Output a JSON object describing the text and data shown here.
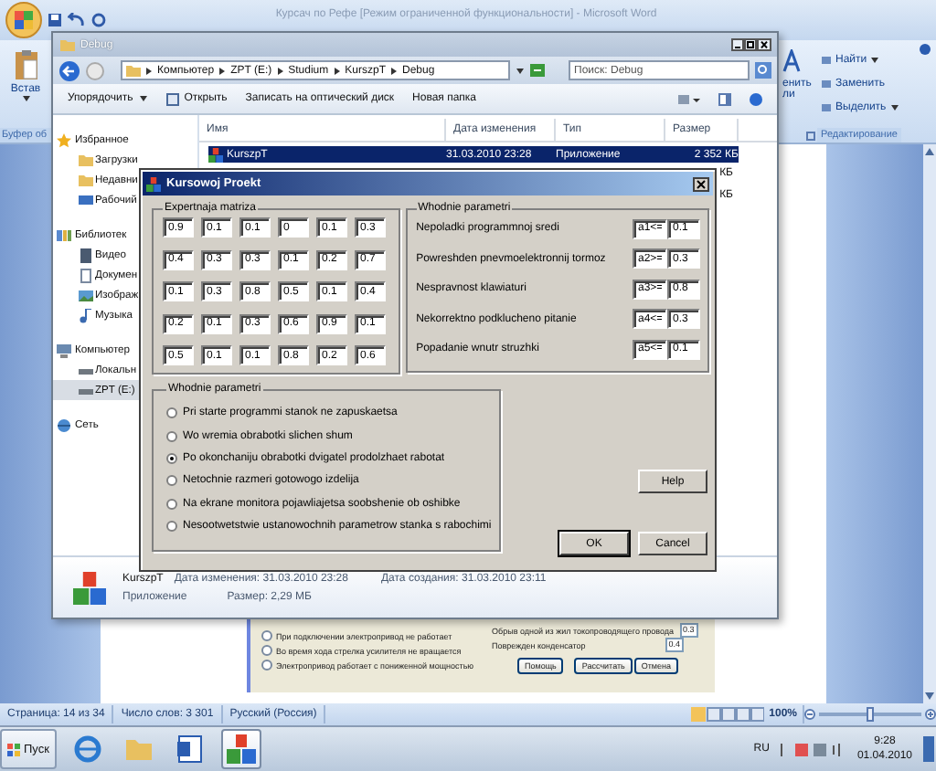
{
  "word": {
    "title": "Курсач по Рефе [Режим ограниченной функциональности] - Microsoft Word",
    "ribbon": {
      "paste_label": "Встав",
      "clipboard_group": "Буфер об",
      "styles_fragments": [
        "енить",
        "ли"
      ],
      "editing": [
        {
          "label": "Найти",
          "dropdown": true
        },
        {
          "label": "Заменить",
          "dropdown": false
        },
        {
          "label": "Выделить",
          "dropdown": true
        }
      ],
      "editing_group": "Редактирование"
    },
    "document_image": {
      "options": [
        {
          "label": "При подключении электропривод не работает",
          "selected": false
        },
        {
          "label": "Во время хода стрелка усилителя не вращается",
          "selected": false
        },
        {
          "label": "Электропривод работает с пониженной мощностью",
          "selected": false
        }
      ],
      "faults": [
        {
          "label": "Обрыв одной из жил токопроводящего провода",
          "value": "0.3"
        },
        {
          "label": "Поврежден конденсатор",
          "value": "0.4"
        }
      ],
      "buttons": [
        "Помощь",
        "Рассчитать",
        "Отмена"
      ]
    },
    "status_bar": {
      "page": "Страница: 14 из 34",
      "words": "Число слов: 3 301",
      "language": "Русский (Россия)",
      "zoom": "100%",
      "zoom_slider": {
        "level": 0.5
      }
    }
  },
  "explorer": {
    "title": "Debug",
    "breadcrumb": [
      "Компьютер",
      "ZPT (E:)",
      "Studium",
      "KurszpT",
      "Debug"
    ],
    "search": {
      "placeholder": "Поиск: Debug"
    },
    "toolbar": [
      {
        "label": "Упорядочить",
        "kind": "menu"
      },
      {
        "label": "Открыть",
        "kind": "open"
      },
      {
        "label": "Записать на оптический диск",
        "kind": "plain"
      },
      {
        "label": "Новая папка",
        "kind": "plain"
      }
    ],
    "nav": [
      {
        "label": "Избранное",
        "kind": "star",
        "selected": false,
        "children": [
          {
            "label": "Загрузки",
            "kind": "folder",
            "selected": false
          },
          {
            "label": "Недавни",
            "kind": "folder",
            "selected": false
          },
          {
            "label": "Рабочий",
            "kind": "desktop",
            "selected": false
          }
        ]
      },
      {
        "label": "Библиотек",
        "kind": "library",
        "selected": false,
        "children": [
          {
            "label": "Видео",
            "kind": "video",
            "selected": false
          },
          {
            "label": "Докумен",
            "kind": "document",
            "selected": false
          },
          {
            "label": "Изображ",
            "kind": "image",
            "selected": false
          },
          {
            "label": "Музыка",
            "kind": "music",
            "selected": false
          }
        ]
      },
      {
        "label": "Компьютер",
        "kind": "computer",
        "selected": false,
        "children": [
          {
            "label": "Локальн",
            "kind": "drive",
            "selected": false
          },
          {
            "label": "ZPT (E:)",
            "kind": "drive",
            "selected": true
          }
        ]
      },
      {
        "label": "Сеть",
        "kind": "network",
        "selected": false
      }
    ],
    "columns": [
      "Имя",
      "Дата изменения",
      "Тип",
      "Размер"
    ],
    "rows": [
      {
        "name": "KurszpT",
        "modified": "31.03.2010 23:28",
        "type": "Приложение",
        "size": "2 352 КБ",
        "selected": true
      }
    ],
    "partial_rows": [
      {
        "size": "КБ"
      },
      {
        "size": "КБ"
      }
    ],
    "details": {
      "name": "KurszpT",
      "modified": "Дата изменения: 31.03.2010 23:28",
      "created": "Дата создания: 31.03.2010 23:11",
      "type": "Приложение",
      "size": "Размер: 2,29 МБ"
    }
  },
  "dialog": {
    "title": "Kursowoj Proekt",
    "matrix": {
      "title": "Expertnaja matriza",
      "rows": [
        [
          "0.9",
          "0.1",
          "0.1",
          "0",
          "0.1",
          "0.3"
        ],
        [
          "0.4",
          "0.3",
          "0.3",
          "0.1",
          "0.2",
          "0.7"
        ],
        [
          "0.1",
          "0.3",
          "0.8",
          "0.5",
          "0.1",
          "0.4"
        ],
        [
          "0.2",
          "0.1",
          "0.3",
          "0.6",
          "0.9",
          "0.1"
        ],
        [
          "0.5",
          "0.1",
          "0.1",
          "0.8",
          "0.2",
          "0.6"
        ]
      ]
    },
    "inputs": {
      "title": "Whodnie parametri",
      "rows": [
        {
          "label": "Nepoladki programmnoj sredi",
          "condition": "a1<=",
          "value": "0.1"
        },
        {
          "label": "Powreshden pnevmoelektronnij tormoz",
          "condition": "a2>=",
          "value": "0.3"
        },
        {
          "label": "Nespravnost klawiaturi",
          "condition": "a3>=",
          "value": "0.8"
        },
        {
          "label": "Nekorrektno podklucheno pitanie",
          "condition": "a4<=",
          "value": "0.3"
        },
        {
          "label": "Popadanie wnutr struzhki",
          "condition": "a5<=",
          "value": "0.1"
        }
      ]
    },
    "outputs": {
      "title": "Whodnie parametri",
      "options": [
        {
          "label": "Pri starte programmi stanok ne zapuskaetsa",
          "selected": false
        },
        {
          "label": "Wo wremia obrabotki slichen shum",
          "selected": false
        },
        {
          "label": "Po okonchaniju obrabotki dvigatel prodolzhaet rabotat",
          "selected": true
        },
        {
          "label": "Netochnie razmeri gotowogo izdelija",
          "selected": false
        },
        {
          "label": "Na ekrane monitora pojawliajetsa soobshenie ob oshibke",
          "selected": false
        },
        {
          "label": "Nesootwetstwie ustanowochnih parametrow stanka s rabochimi",
          "selected": false
        }
      ]
    },
    "help_button": "Help",
    "ok_button": "OK",
    "cancel_button": "Cancel"
  },
  "taskbar": {
    "start": "Пуск",
    "apps": [
      {
        "kind": "browser",
        "selected": false
      },
      {
        "kind": "folder",
        "selected": false
      },
      {
        "kind": "word",
        "selected": false
      },
      {
        "kind": "app",
        "selected": true
      }
    ],
    "language": "RU",
    "time": "9:28",
    "date": "01.04.2010"
  }
}
